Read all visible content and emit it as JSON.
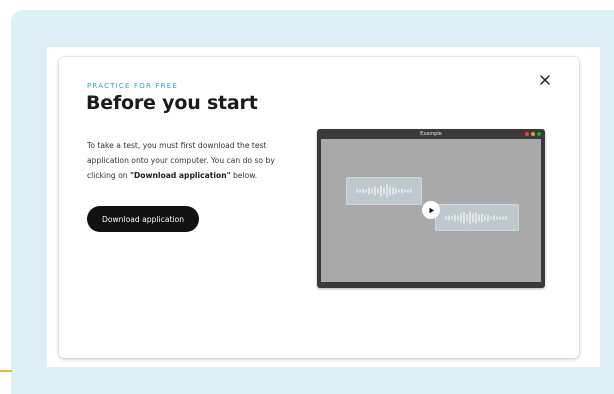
{
  "modal": {
    "eyebrow": "PRACTICE FOR FREE",
    "title": "Before you start",
    "description": {
      "part1": "To take a test, you must first download the test application onto your computer. You can do so by clicking on ",
      "bold": "\"Download application\"",
      "part2": " below."
    },
    "download_button_label": "Download application",
    "close_icon": "close-icon"
  },
  "preview": {
    "window_title": "Example",
    "play_icon": "play-icon",
    "window_dot_colors": [
      "#e0443e",
      "#dea123",
      "#1aab29"
    ]
  },
  "colors": {
    "backdrop": "#dfeff6",
    "accent_blue": "#3b9fc4",
    "accent_yellow": "#f2b43a",
    "button_bg": "#111111"
  }
}
